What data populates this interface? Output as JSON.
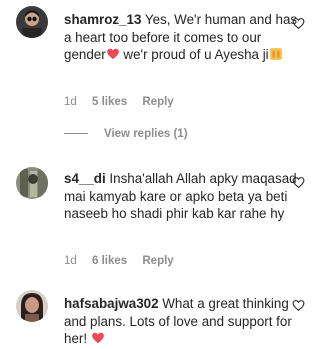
{
  "comments": [
    {
      "username": "shamroz_13",
      "text_before_heart": " Yes, We'r human and has a heart too before it comes to our gender",
      "text_after_heart": " we'r proud of u Ayesha ji",
      "time": "1d",
      "likes": "5 likes",
      "reply": "Reply",
      "view_replies": "View replies (1)",
      "emoji_1": "red-heart-emoji",
      "emoji_2": "raising-hands-emoji"
    },
    {
      "username": "s4__di",
      "text": " Insha'allah Allah apky maqasad mai kamyab kare or apko beta ya beti naseeb ho shadi phir kab kar rahe hy",
      "time": "1d",
      "likes": "6 likes",
      "reply": "Reply"
    },
    {
      "username": "hafsabajwa302",
      "text": " What a great thinking and plans. Lots of love and support for her!",
      "emoji": "red-heart-emoji"
    }
  ],
  "colors": {
    "text": "#262626",
    "muted": "#8e8e8e",
    "heart_emoji": "#ed4956"
  },
  "icons": {
    "like": "heart-outline-icon"
  }
}
